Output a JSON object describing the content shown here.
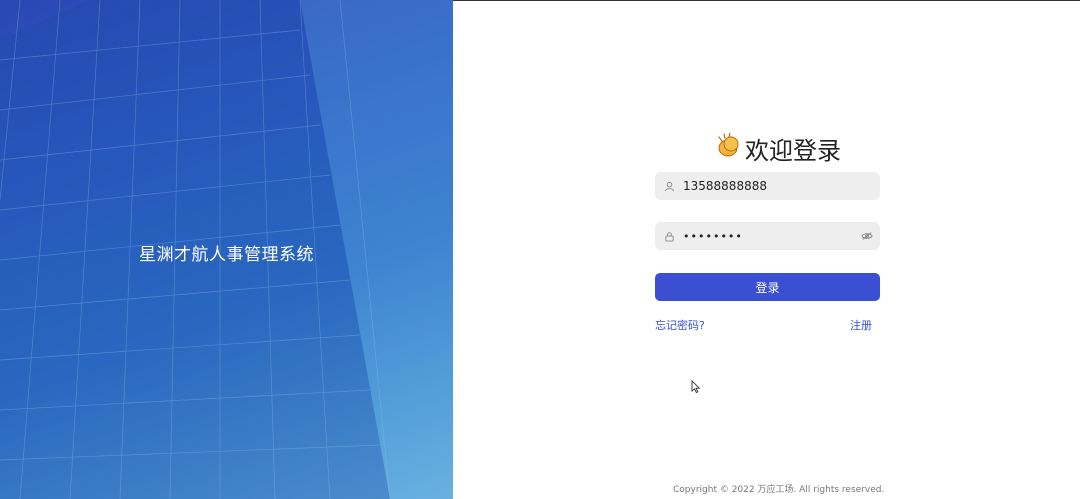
{
  "hero": {
    "title": "星渊才航人事管理系统"
  },
  "login": {
    "welcome_text": "欢迎登录",
    "welcome_icon": "clapping-hands-icon",
    "username": {
      "value": "13588888888",
      "icon": "user-icon"
    },
    "password": {
      "value": "••••••••",
      "icon": "lock-icon",
      "toggle_icon": "eye-off-icon"
    },
    "submit_label": "登录",
    "forgot_label": "忘记密码?",
    "register_label": "注册"
  },
  "footer": {
    "copyright": "Copyright © 2022 万应工场. All rights reserved."
  },
  "colors": {
    "accent": "#3a4fd1",
    "hero_start": "#2b47b3",
    "hero_end": "#6ab4e2",
    "field_bg": "#eeeeee"
  }
}
